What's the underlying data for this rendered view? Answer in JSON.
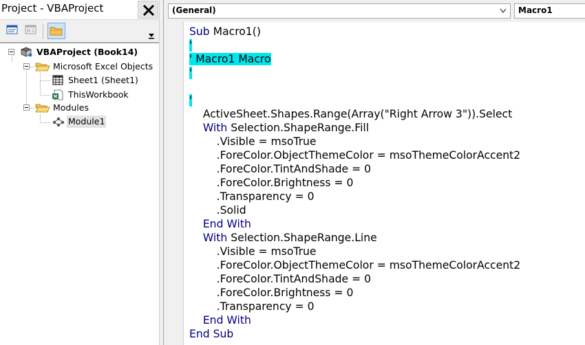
{
  "project_pane": {
    "title": "Project - VBAProject",
    "toolbar": {
      "view_code": "view-code-icon",
      "view_object": "view-object-icon",
      "toggle_folders": "folder-icon"
    }
  },
  "tree": {
    "project": "VBAProject (Book14)",
    "excel_objects_folder": "Microsoft Excel Objects",
    "sheet1": "Sheet1 (Sheet1)",
    "thisworkbook": "ThisWorkbook",
    "modules_folder": "Modules",
    "module1": "Module1"
  },
  "code_window": {
    "object_dropdown": "(General)",
    "procedure_dropdown": "Macro1",
    "lines": [
      [
        {
          "t": "Sub ",
          "c": "kw"
        },
        {
          "t": "Macro1()",
          "c": ""
        }
      ],
      [
        {
          "t": "'",
          "c": "cm"
        }
      ],
      [
        {
          "t": "' Macro1 Macro",
          "c": "cm"
        }
      ],
      [
        {
          "t": "'",
          "c": "cm"
        }
      ],
      [],
      [
        {
          "t": "'",
          "c": "cm"
        }
      ],
      [
        {
          "t": "    ActiveSheet.Shapes.Range(Array(\"Right Arrow 3\")).Select",
          "c": ""
        }
      ],
      [
        {
          "t": "    With ",
          "c": "kw"
        },
        {
          "t": "Selection.ShapeRange.Fill",
          "c": ""
        }
      ],
      [
        {
          "t": "        .Visible = msoTrue",
          "c": ""
        }
      ],
      [
        {
          "t": "        .ForeColor.ObjectThemeColor = msoThemeColorAccent2",
          "c": ""
        }
      ],
      [
        {
          "t": "        .ForeColor.TintAndShade = 0",
          "c": ""
        }
      ],
      [
        {
          "t": "        .ForeColor.Brightness = 0",
          "c": ""
        }
      ],
      [
        {
          "t": "        .Transparency = 0",
          "c": ""
        }
      ],
      [
        {
          "t": "        .Solid",
          "c": ""
        }
      ],
      [
        {
          "t": "    End With",
          "c": "kw"
        }
      ],
      [
        {
          "t": "    With ",
          "c": "kw"
        },
        {
          "t": "Selection.ShapeRange.Line",
          "c": ""
        }
      ],
      [
        {
          "t": "        .Visible = msoTrue",
          "c": ""
        }
      ],
      [
        {
          "t": "        .ForeColor.ObjectThemeColor = msoThemeColorAccent2",
          "c": ""
        }
      ],
      [
        {
          "t": "        .ForeColor.TintAndShade = 0",
          "c": ""
        }
      ],
      [
        {
          "t": "        .ForeColor.Brightness = 0",
          "c": ""
        }
      ],
      [
        {
          "t": "        .Transparency = 0",
          "c": ""
        }
      ],
      [
        {
          "t": "    End With",
          "c": "kw"
        }
      ],
      [
        {
          "t": "End Sub",
          "c": "kw"
        }
      ]
    ]
  },
  "colors": {
    "keyword": "#00007f",
    "comment_highlight": "#00e6ec",
    "selection_gray": "#e3e3e3"
  }
}
